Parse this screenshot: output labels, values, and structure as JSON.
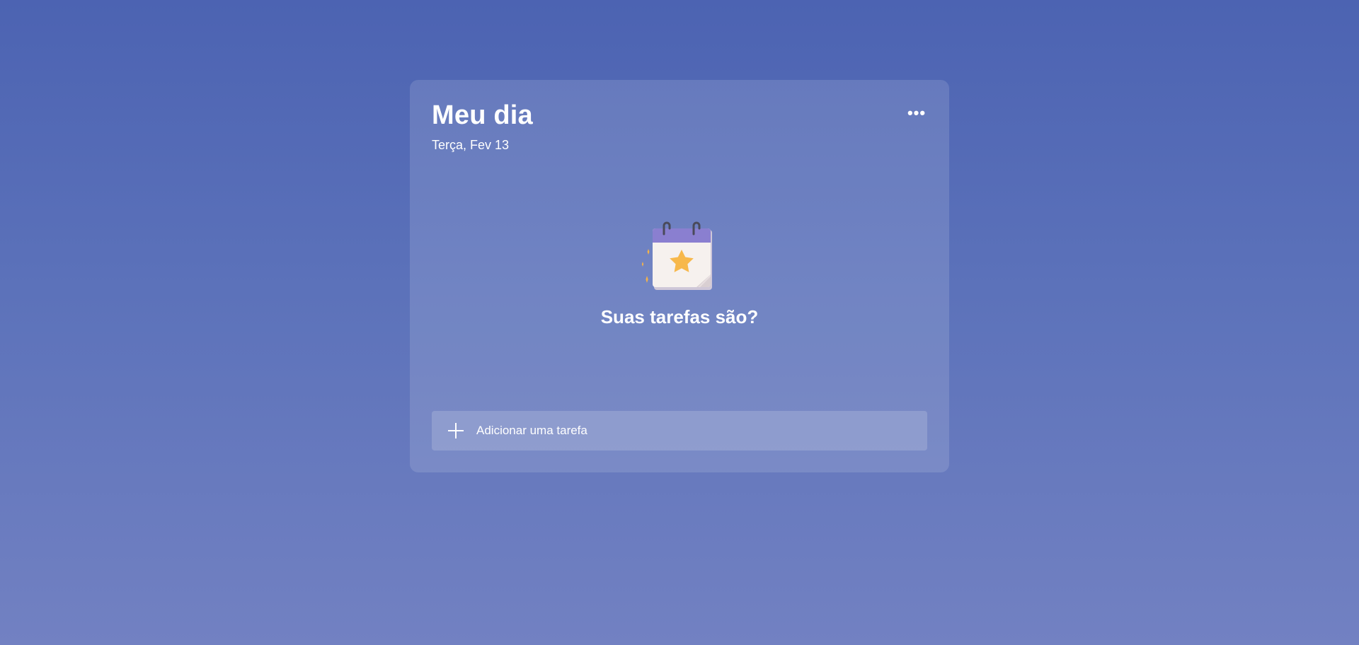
{
  "header": {
    "title": "Meu dia",
    "date": "Terça, Fev 13",
    "more_icon": "more-horizontal-icon",
    "more_glyph": "•••"
  },
  "empty_state": {
    "illustration_icon": "calendar-star-icon",
    "message": "Suas tarefas são?"
  },
  "add_task": {
    "icon": "plus-icon",
    "label": "Adicionar uma tarefa"
  },
  "colors": {
    "background_top": "#4c63b2",
    "background_bottom": "#7281c2",
    "calendar_header": "#8a7fd0",
    "star": "#f7b84b",
    "sparkle": "#f3b24a"
  }
}
